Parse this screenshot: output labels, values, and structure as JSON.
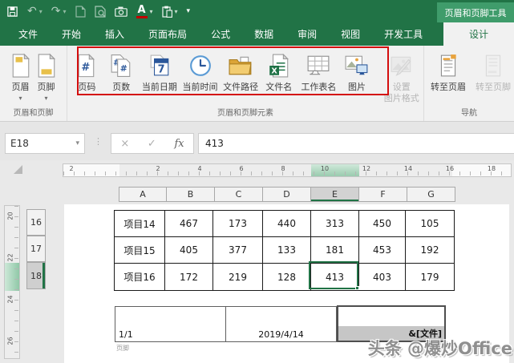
{
  "colors": {
    "accent_green": "#217346",
    "context_tab_green": "#3f9c6b",
    "highlight_red": "#d40e0e",
    "selection_green": "#217346",
    "footer_field_gray": "#c6c6c6"
  },
  "titlebar": {
    "context_tool_label": "页眉和页脚工具",
    "font_color_letter": "A"
  },
  "tabs": [
    {
      "label": "文件"
    },
    {
      "label": "开始"
    },
    {
      "label": "插入"
    },
    {
      "label": "页面布局"
    },
    {
      "label": "公式"
    },
    {
      "label": "数据"
    },
    {
      "label": "审阅"
    },
    {
      "label": "视图"
    },
    {
      "label": "开发工具"
    },
    {
      "label": "设计"
    }
  ],
  "ribbon": {
    "group1": {
      "label": "页眉和页脚",
      "header_btn": "页眉",
      "footer_btn": "页脚"
    },
    "group2": {
      "label": "页眉和页脚元素",
      "elements": [
        {
          "label": "页码"
        },
        {
          "label": "页数"
        },
        {
          "label": "当前日期"
        },
        {
          "label": "当前时间"
        },
        {
          "label": "文件路径"
        },
        {
          "label": "文件名"
        },
        {
          "label": "工作表名"
        },
        {
          "label": "图片"
        }
      ],
      "format_picture_line1": "设置",
      "format_picture_line2": "图片格式"
    },
    "group3": {
      "label": "导航",
      "goto_header": "转至页眉",
      "goto_footer": "转至页脚"
    }
  },
  "formula_bar": {
    "name_box": "E18",
    "cancel": "×",
    "enter": "✓",
    "fx": "fx",
    "value": "413"
  },
  "sheet": {
    "h_ruler": {
      "margin_label": "2",
      "numbers": [
        "2",
        "4",
        "6",
        "8",
        "10",
        "12",
        "14",
        "16",
        "18"
      ]
    },
    "v_ruler": {
      "numbers": [
        "20",
        "22",
        "24",
        "26"
      ]
    },
    "columns": [
      "A",
      "B",
      "C",
      "D",
      "E",
      "F",
      "G"
    ],
    "selected_column": "E",
    "rows": [
      "16",
      "17",
      "18"
    ],
    "selected_row": "18",
    "table": {
      "rows": [
        {
          "name": "项目14",
          "values": [
            "467",
            "173",
            "440",
            "313",
            "450",
            "105"
          ]
        },
        {
          "name": "项目15",
          "values": [
            "405",
            "377",
            "133",
            "181",
            "453",
            "192"
          ]
        },
        {
          "name": "项目16",
          "values": [
            "172",
            "219",
            "128",
            "413",
            "403",
            "179"
          ]
        }
      ]
    },
    "footer": {
      "page": "1/1",
      "date": "2019/4/14",
      "file_field": "&[文件]",
      "area_label": "页脚"
    },
    "watermark": "头条 @爆炒Office"
  }
}
